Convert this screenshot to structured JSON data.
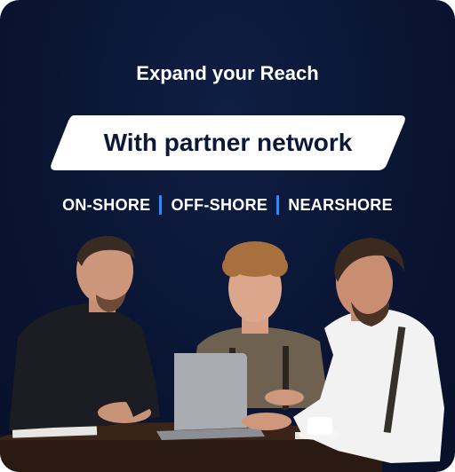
{
  "headline": "Expand your Reach",
  "banner": {
    "text": "With partner network"
  },
  "services": [
    {
      "label": "ON-SHORE"
    },
    {
      "label": "OFF-SHORE"
    },
    {
      "label": "NEARSHORE"
    }
  ],
  "colors": {
    "background": "#0a1533",
    "banner": "#ffffff",
    "banner_text": "#0b1838",
    "separator": "#2a8cff"
  },
  "photo": {
    "subject": "three-businessmen-at-laptop"
  }
}
